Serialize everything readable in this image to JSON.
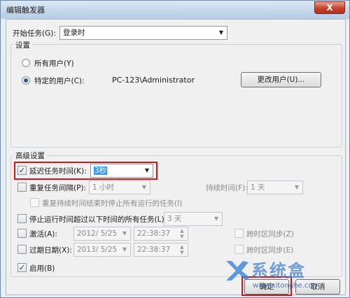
{
  "window": {
    "title": "编辑触发器",
    "close_label": "X"
  },
  "start_task": {
    "label": "开始任务(G):",
    "value": "登录时"
  },
  "settings": {
    "title": "设置",
    "any_user_label": "所有用户(Y)",
    "specific_user_label": "特定的用户(C):",
    "user_value": "PC-123\\Administrator",
    "change_user_button": "更改用户(U)..."
  },
  "advanced": {
    "title": "高级设置",
    "delay": {
      "label": "延迟任务时间(K):",
      "value": "3秒",
      "checked": true
    },
    "repeat": {
      "label": "重复任务间隔(P):",
      "value": "1 小时",
      "duration_label": "持续时间(F):",
      "duration_value": "1 天",
      "stop_label": "重复持续时间结束时停止所有运行的任务(I)"
    },
    "stop_longer": {
      "label": "停止运行时间超过以下时间的所有任务(L):",
      "value": "3 天"
    },
    "activate": {
      "label": "激活(A):",
      "date": "2012/ 5/25",
      "time": "22:38:37",
      "sync_label": "跨时区同步(Z)"
    },
    "expire": {
      "label": "过期日期(X):",
      "date": "2013/ 5/25",
      "time": "22:38:37",
      "sync_label": "跨时区同步(E)"
    },
    "enabled": {
      "label": "启用(B)",
      "checked": true
    }
  },
  "buttons": {
    "ok": "确定",
    "cancel": "取消"
  },
  "icons": {
    "dropdown": "chevron-down-icon",
    "spin": "spin-arrows-icon",
    "check": "checkmark-icon"
  },
  "watermark": {
    "text_cn": "系统盒",
    "text_url": "www.xitonghe.com"
  },
  "colors": {
    "highlight": "#d0151c",
    "selection": "#3399ff",
    "accent": "#2a5c95"
  }
}
